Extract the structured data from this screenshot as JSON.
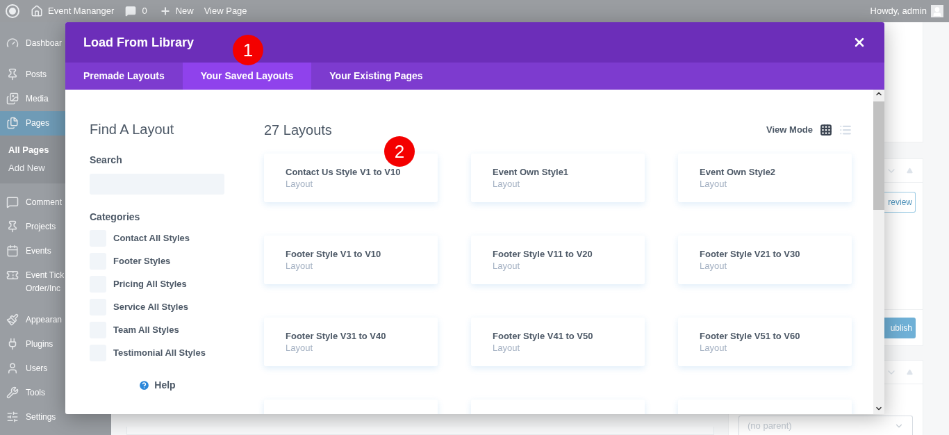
{
  "admin_bar": {
    "site": "Event Mananger",
    "comments": "0",
    "new": "New",
    "view": "View Page",
    "greeting": "Howdy, admin"
  },
  "sidebar": {
    "items": [
      {
        "label": "Dashboar",
        "selected": false
      },
      {
        "label": "Posts",
        "selected": false
      },
      {
        "label": "Media",
        "selected": false
      },
      {
        "label": "Pages",
        "selected": true,
        "children": [
          {
            "label": "All Pages",
            "selected": true
          },
          {
            "label": "Add New",
            "selected": false
          }
        ]
      },
      {
        "label": "Comment",
        "selected": false
      },
      {
        "label": "Projects",
        "selected": false
      },
      {
        "label": "Events",
        "selected": false
      },
      {
        "label": "Event Tick",
        "label_line_2": "Order/Inc",
        "selected": false
      },
      {
        "label": "Appearan",
        "selected": false
      },
      {
        "label": "Plugins",
        "selected": false
      },
      {
        "label": "Users",
        "selected": false
      },
      {
        "label": "Tools",
        "selected": false
      },
      {
        "label": "Settings",
        "selected": false
      }
    ]
  },
  "side_panel": {
    "preview_button": "review",
    "publish_button": "ublish",
    "parent_select": "(no parent)"
  },
  "modal": {
    "title": "Load From Library",
    "tabs": [
      {
        "label": "Premade Layouts",
        "selected": false
      },
      {
        "label": "Your Saved Layouts",
        "selected": true,
        "marker": "1"
      },
      {
        "label": "Your Existing Pages",
        "selected": false
      }
    ],
    "filter": {
      "heading": "Find A Layout",
      "search_label": "Search",
      "categories_label": "Categories",
      "categories": [
        {
          "label": "Contact All Styles",
          "checked": false
        },
        {
          "label": "Footer Styles",
          "checked": false
        },
        {
          "label": "Pricing All Styles",
          "checked": false
        },
        {
          "label": "Service All Styles",
          "checked": false
        },
        {
          "label": "Team All Styles",
          "checked": false
        },
        {
          "label": "Testimonial All Styles",
          "checked": false
        }
      ],
      "help": "Help"
    },
    "count": "27 Layouts",
    "view_mode_label": "View Mode",
    "view_modes": [
      {
        "kind": "grid",
        "selected": true
      },
      {
        "kind": "list",
        "selected": false
      }
    ],
    "layouts": [
      {
        "kind": "card",
        "title": "Contact Us Style V1 to V10",
        "subtitle": "Layout",
        "marker": "2"
      },
      {
        "kind": "card",
        "title": "Event Own Style1",
        "subtitle": "Layout"
      },
      {
        "kind": "card",
        "title": "Event Own Style2",
        "subtitle": "Layout"
      },
      {
        "kind": "card",
        "title": "Footer Style V1 to V10",
        "subtitle": "Layout"
      },
      {
        "kind": "card",
        "title": "Footer Style V11 to V20",
        "subtitle": "Layout"
      },
      {
        "kind": "card",
        "title": "Footer Style V21 to V30",
        "subtitle": "Layout"
      },
      {
        "kind": "card",
        "title": "Footer Style V31 to V40",
        "subtitle": "Layout"
      },
      {
        "kind": "card",
        "title": "Footer Style V41 to V50",
        "subtitle": "Layout"
      },
      {
        "kind": "card",
        "title": "Footer Style V51 to V60",
        "subtitle": "Layout"
      },
      {
        "kind": "cut"
      },
      {
        "kind": "cut"
      },
      {
        "kind": "cut"
      }
    ]
  }
}
